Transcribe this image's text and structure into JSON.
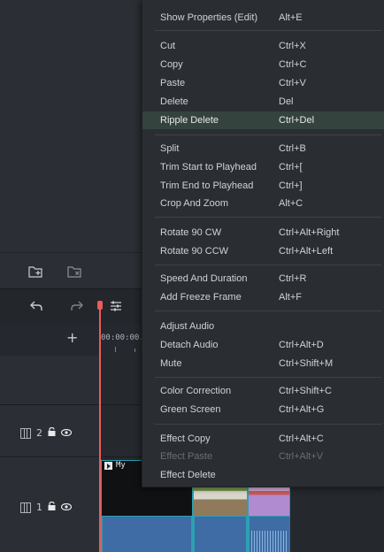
{
  "context_menu": {
    "items": [
      {
        "label": "Show Properties (Edit)",
        "shortcut": "Alt+E"
      },
      {
        "label": "Cut",
        "shortcut": "Ctrl+X"
      },
      {
        "label": "Copy",
        "shortcut": "Ctrl+C"
      },
      {
        "label": "Paste",
        "shortcut": "Ctrl+V"
      },
      {
        "label": "Delete",
        "shortcut": "Del"
      },
      {
        "label": "Ripple Delete",
        "shortcut": "Ctrl+Del"
      },
      {
        "label": "Split",
        "shortcut": "Ctrl+B"
      },
      {
        "label": "Trim Start to Playhead",
        "shortcut": "Ctrl+["
      },
      {
        "label": "Trim End to Playhead",
        "shortcut": "Ctrl+]"
      },
      {
        "label": "Crop And Zoom",
        "shortcut": "Alt+C"
      },
      {
        "label": "Rotate 90 CW",
        "shortcut": "Ctrl+Alt+Right"
      },
      {
        "label": "Rotate 90 CCW",
        "shortcut": "Ctrl+Alt+Left"
      },
      {
        "label": "Speed And Duration",
        "shortcut": "Ctrl+R"
      },
      {
        "label": "Add Freeze Frame",
        "shortcut": "Alt+F"
      },
      {
        "label": "Adjust Audio",
        "shortcut": ""
      },
      {
        "label": "Detach Audio",
        "shortcut": "Ctrl+Alt+D"
      },
      {
        "label": "Mute",
        "shortcut": "Ctrl+Shift+M"
      },
      {
        "label": "Color Correction",
        "shortcut": "Ctrl+Shift+C"
      },
      {
        "label": "Green Screen",
        "shortcut": "Ctrl+Alt+G"
      },
      {
        "label": "Effect Copy",
        "shortcut": "Ctrl+Alt+C"
      },
      {
        "label": "Effect Paste",
        "shortcut": "Ctrl+Alt+V",
        "disabled": true
      },
      {
        "label": "Effect Delete",
        "shortcut": ""
      }
    ],
    "highlighted_item": "Ripple Delete"
  },
  "toolbar": {
    "undo_icon": "undo-icon",
    "redo_icon": "redo-icon",
    "settings_icon": "sliders-icon"
  },
  "media_icons": [
    "new-folder-icon",
    "delete-folder-icon"
  ],
  "ruler": {
    "timecode": "00:00:00."
  },
  "tracks": [
    {
      "number": "2",
      "icons": [
        "film-icon",
        "lock-icon",
        "eye-icon"
      ]
    },
    {
      "number": "1",
      "icons": [
        "film-icon",
        "lock-icon",
        "eye-icon"
      ]
    }
  ],
  "clip": {
    "title": "My"
  },
  "colors": {
    "playhead": "#ef5a5a",
    "clip_border": "#2d9fb2",
    "audio_clip": "#3f6ca4",
    "menu_highlight": "#35433f"
  }
}
